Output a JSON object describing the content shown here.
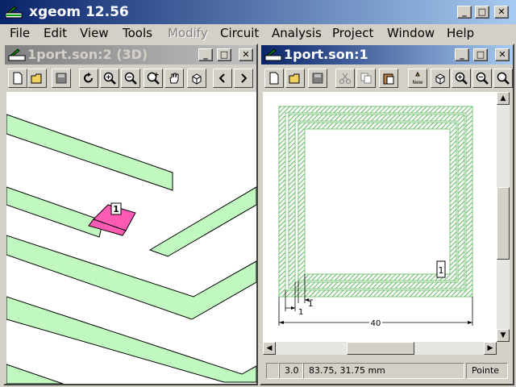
{
  "app": {
    "title": "xgeom 12.56"
  },
  "menu": [
    "File",
    "Edit",
    "View",
    "Tools",
    "Modify",
    "Circuit",
    "Analysis",
    "Project",
    "Window",
    "Help"
  ],
  "menu_disabled": "Modify",
  "windows": {
    "left": {
      "title": "1port.son:2 (3D)",
      "port_label": "1"
    },
    "right": {
      "title": "1port.son:1",
      "port_label": "1",
      "dim_small_1": "1",
      "dim_small_2": "1",
      "dim_total": "40"
    }
  },
  "status": {
    "cell1": "",
    "cell2": "3.0",
    "cell3": "83.75, 31.75 mm",
    "cell4": "Pointe"
  },
  "colors": {
    "accent": "#0a246a",
    "metal_fill": "#c0f8c0",
    "hatch": "#5cb85c",
    "port": "#ff5ab4"
  }
}
